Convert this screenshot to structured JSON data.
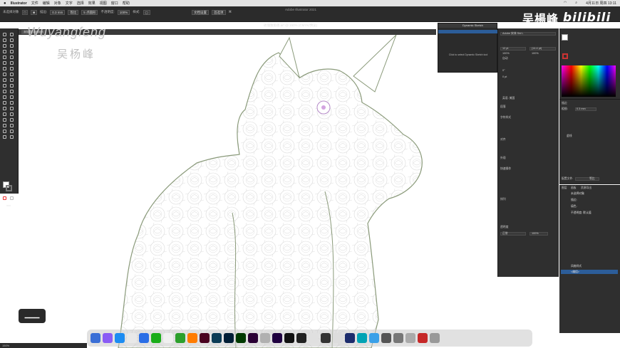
{
  "menubar": {
    "items": [
      "Illustrator",
      "文件",
      "编辑",
      "对象",
      "文字",
      "选择",
      "效果",
      "视图",
      "窗口",
      "帮助"
    ],
    "clock": "4月11日 周四 13:11"
  },
  "window": {
    "title": "Adobe Illustrator 2021"
  },
  "control_bar": {
    "selection_label": "未选择对象",
    "stroke_label": "描边:",
    "stroke_value": "0.3 mm",
    "profile_value": "等比",
    "brush_value": "5 点圆形",
    "opacity_label": "不透明度:",
    "opacity_value": "100%",
    "style_label": "样式:",
    "doc_setup_button": "文档设置",
    "prefs_button": "首选项"
  },
  "tabs": {
    "active_tab": "未标题-1@50%",
    "doc_title": "玫瑰独角兽.ai* @ 150% (CMYK/预览)"
  },
  "watermark": {
    "latin": "Wuyangfeng",
    "cjk": "吴杨峰"
  },
  "brand": {
    "name": "吴楊峰",
    "site": "bilibili"
  },
  "dynamic_sketch": {
    "tab_label": "Dynamic Sketch",
    "message": "Click to select Dynamic Sketch tool"
  },
  "properties": {
    "font": "Adobe 宋体 Std L",
    "font_size": "12 pt",
    "leading": "(14.4 pt)",
    "tracking": "100%",
    "scale": "100%",
    "auto": "自动",
    "angle": "0°",
    "zero_pt": "0 pt",
    "lang": "英语: 美国",
    "paragraph_title": "段落",
    "opentype_title": "字符样式",
    "align_label": "对齐",
    "appearance_label": "外观",
    "quick_actions": "快速操作",
    "arrange_label": "排列",
    "transparency_title": "透明度",
    "normal": "正常",
    "opacity": "100%"
  },
  "stroke_panel": {
    "title": "描边",
    "weight_label": "粗细:",
    "weight_value": "0.3 mm",
    "dashed_label": "虚线",
    "profile_label": "配置文件:",
    "profile_value": "等比"
  },
  "layers_panel": {
    "tabs": [
      "图层",
      "画板",
      "资源导出"
    ],
    "rows": [
      {
        "label": "未选择对象"
      },
      {
        "label": "描边:"
      },
      {
        "label": "填色:"
      },
      {
        "label": "不透明度: 默认值"
      }
    ],
    "bottom_rows": [
      {
        "label": "风格样式"
      },
      {
        "label": "<编组>"
      }
    ]
  },
  "status": {
    "zoom": "150%"
  },
  "hud": {
    "label": "▁▁▁"
  },
  "colors": {
    "panel_bg": "#2f2f2f",
    "accent": "#2c5d99",
    "outline": "#8a9a7a",
    "rose_line": "#d4d4d4"
  }
}
